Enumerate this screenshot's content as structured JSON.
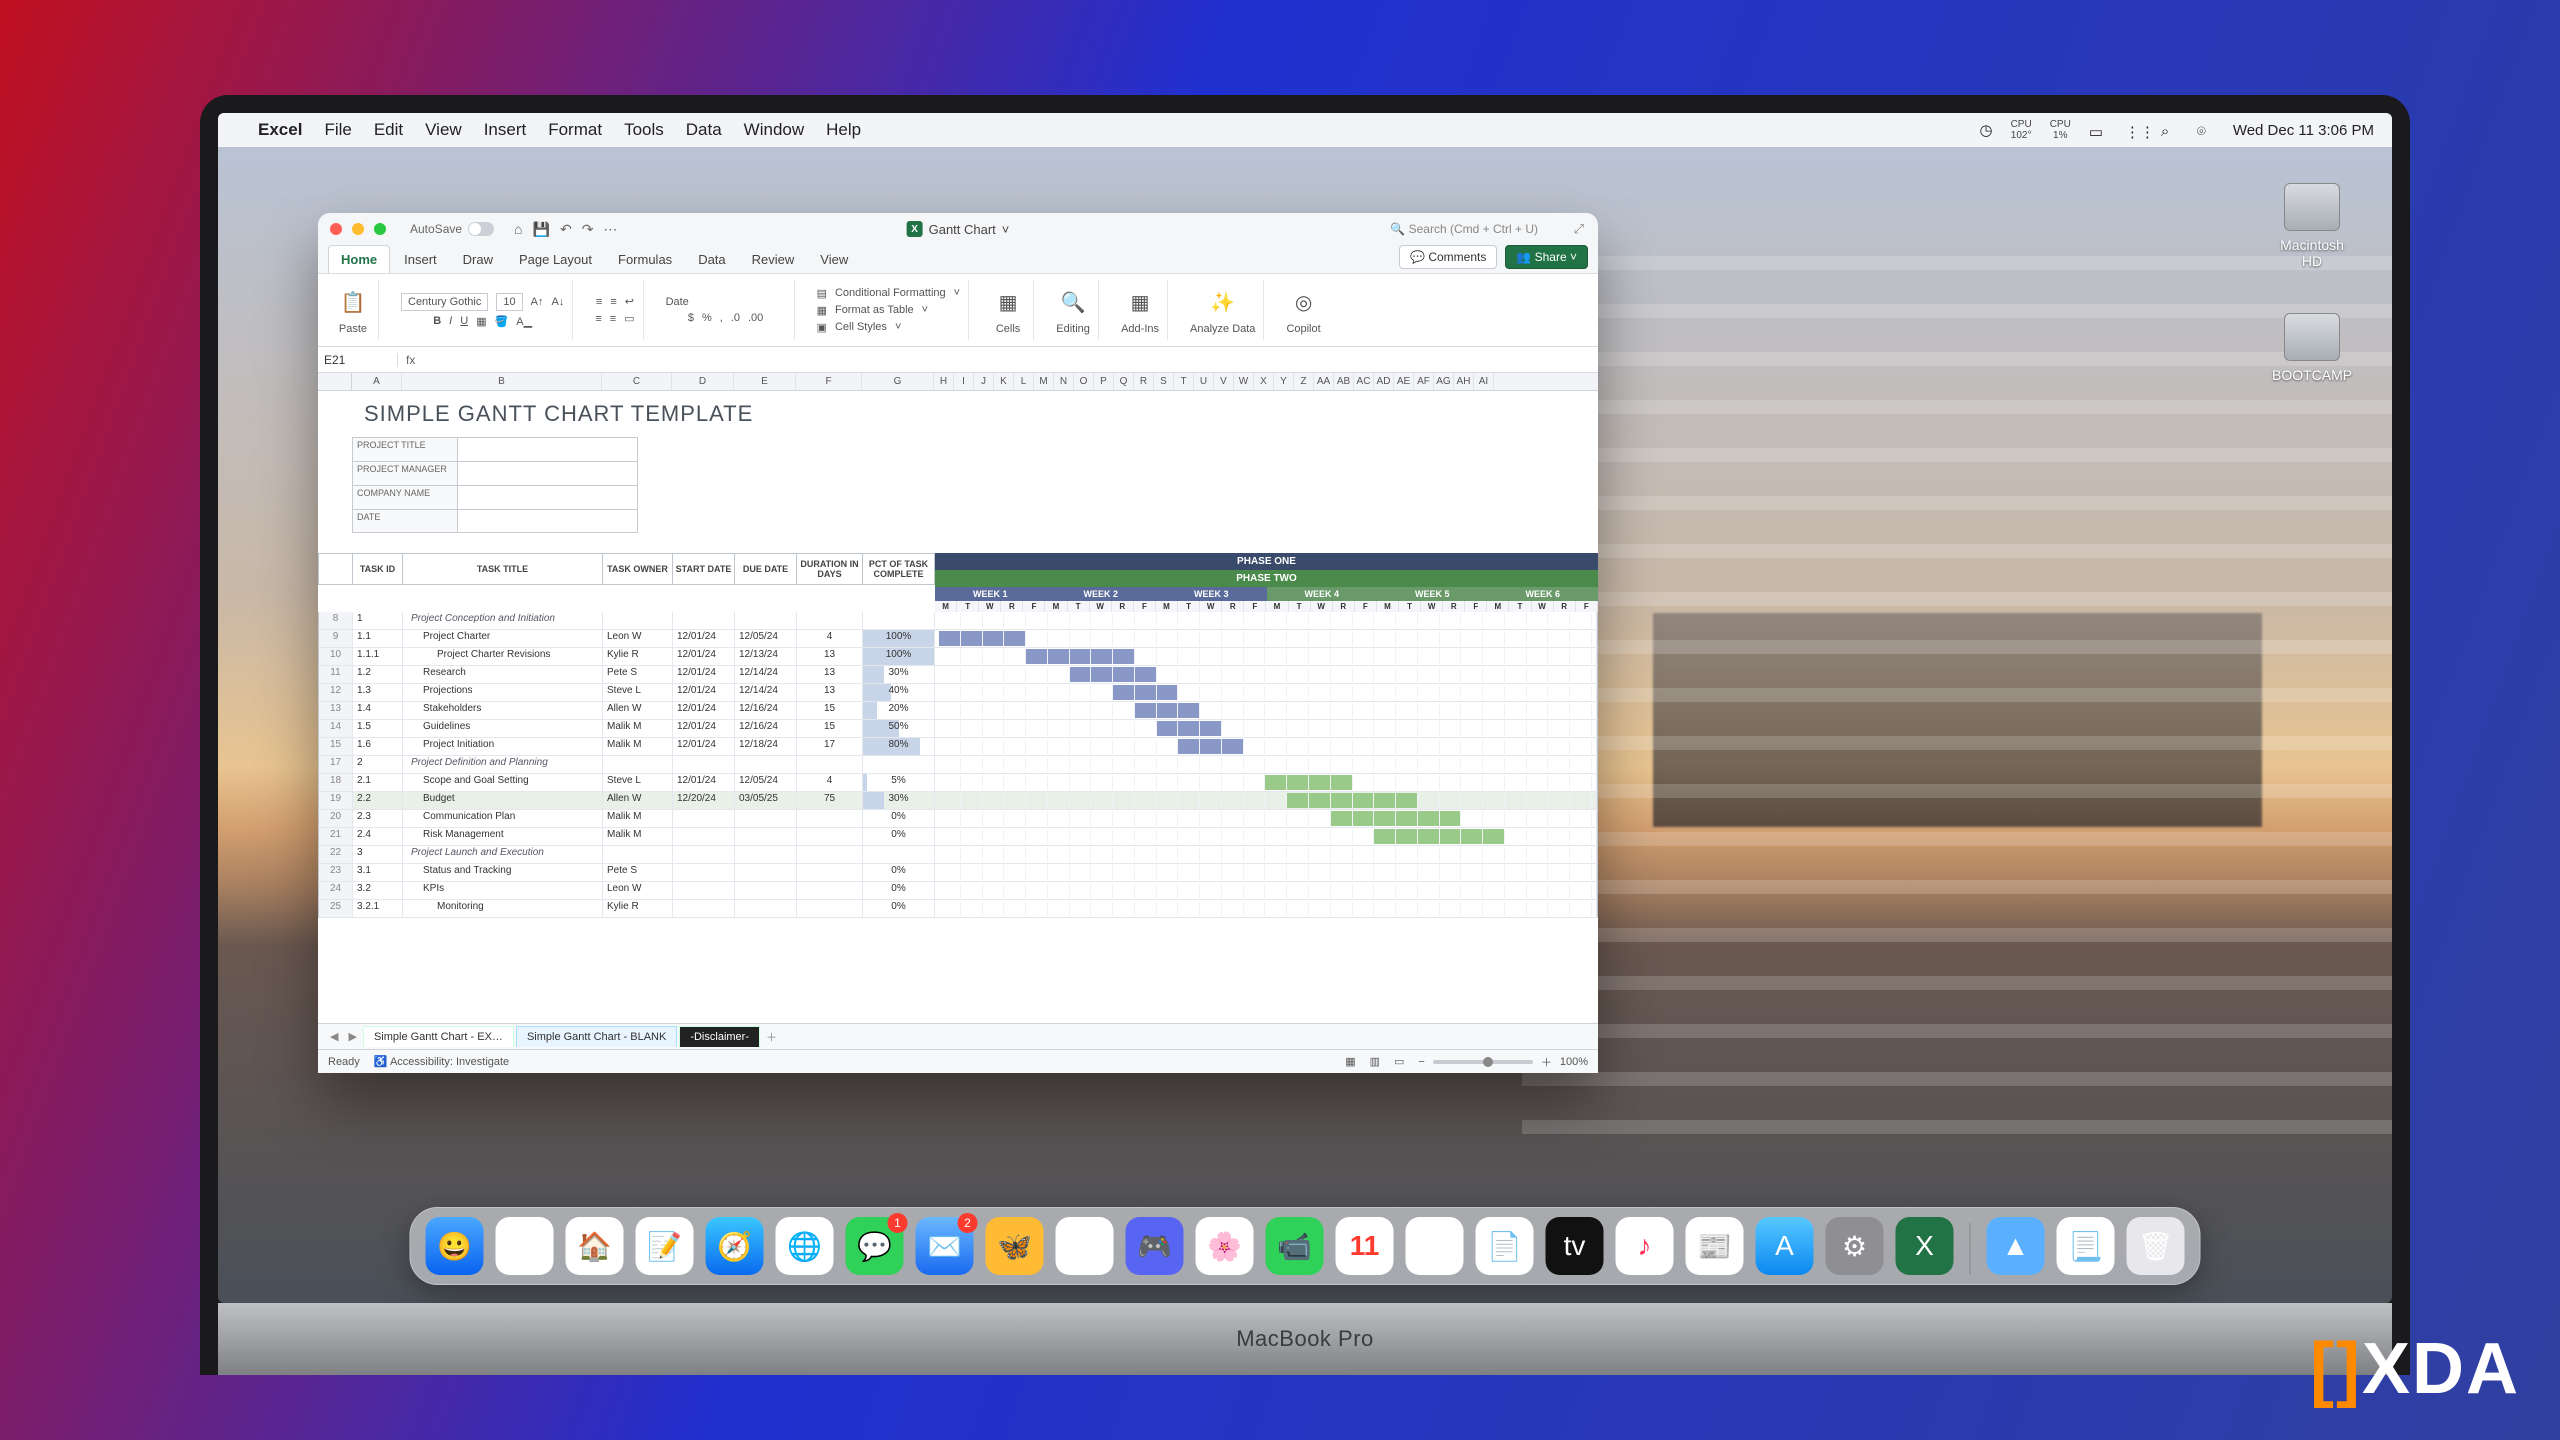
{
  "menubar": {
    "app": "Excel",
    "items": [
      "File",
      "Edit",
      "View",
      "Insert",
      "Format",
      "Tools",
      "Data",
      "Window",
      "Help"
    ],
    "cpu": {
      "label": "CPU",
      "value": "102°"
    },
    "gpu": {
      "label": "CPU",
      "value": "1%"
    },
    "datetime": "Wed Dec 11  3:06 PM"
  },
  "drives": [
    {
      "name": "Macintosh HD"
    },
    {
      "name": "BOOTCAMP"
    }
  ],
  "dock": {
    "messagesBadge": "1",
    "mailBadge": "2",
    "calendarDay": "11"
  },
  "chin": "MacBook Pro",
  "watermark": "XDA",
  "excel": {
    "autosave": "AutoSave",
    "docname": "Gantt Chart",
    "search": "Search (Cmd + Ctrl + U)",
    "tabs": [
      "Home",
      "Insert",
      "Draw",
      "Page Layout",
      "Formulas",
      "Data",
      "Review",
      "View"
    ],
    "activeTab": "Home",
    "comments": "Comments",
    "share": "Share",
    "font": {
      "name": "Century Gothic",
      "size": "10"
    },
    "numberFormat": "Date",
    "ribbonGroups": {
      "paste": "Paste",
      "condFmt": "Conditional Formatting",
      "asTable": "Format as Table",
      "cellStyles": "Cell Styles",
      "cells": "Cells",
      "editing": "Editing",
      "addins": "Add-Ins",
      "analyze": "Analyze Data",
      "copilot": "Copilot"
    },
    "namebox": "E21",
    "cols": [
      "A",
      "B",
      "C",
      "D",
      "E",
      "F",
      "G",
      "H",
      "I",
      "J",
      "K",
      "L",
      "M",
      "N",
      "O",
      "P",
      "Q",
      "R",
      "S",
      "T",
      "U",
      "V",
      "W",
      "X",
      "Y",
      "Z",
      "AA",
      "AB",
      "AC",
      "AD",
      "AE",
      "AF",
      "AG",
      "AH",
      "AI"
    ],
    "title": "SIMPLE GANTT CHART TEMPLATE",
    "metaLabels": [
      "PROJECT TITLE",
      "PROJECT MANAGER",
      "COMPANY NAME",
      "DATE"
    ],
    "gantt": {
      "phases": [
        "PHASE ONE",
        "PHASE TWO"
      ],
      "weeks": [
        "WEEK 1",
        "WEEK 2",
        "WEEK 3",
        "WEEK 4",
        "WEEK 5",
        "WEEK 6"
      ],
      "daycycle": [
        "M",
        "T",
        "W",
        "R",
        "F",
        "M",
        "T",
        "W",
        "R",
        "F",
        "M",
        "T",
        "W",
        "R",
        "F",
        "M",
        "T",
        "W",
        "R",
        "F",
        "M",
        "T",
        "W",
        "R",
        "F",
        "M",
        "T",
        "W",
        "R",
        "F"
      ],
      "headers": [
        "TASK ID",
        "TASK TITLE",
        "TASK OWNER",
        "START DATE",
        "DUE DATE",
        "DURATION IN DAYS",
        "PCT OF TASK COMPLETE"
      ]
    },
    "rows": [
      {
        "rn": 8,
        "id": "1",
        "title": "Project Conception and Initiation",
        "section": true,
        "phase": 1
      },
      {
        "rn": 9,
        "id": "1.1",
        "title": "Project Charter",
        "owner": "Leon W",
        "start": "12/01/24",
        "due": "12/05/24",
        "dur": "4",
        "pct": 100,
        "tl": [
          0,
          4
        ],
        "phase": 1,
        "indent": 1
      },
      {
        "rn": 10,
        "id": "1.1.1",
        "title": "Project Charter Revisions",
        "owner": "Kylie R",
        "start": "12/01/24",
        "due": "12/13/24",
        "dur": "13",
        "pct": 100,
        "tl": [
          4,
          9
        ],
        "phase": 1,
        "indent": 2
      },
      {
        "rn": 11,
        "id": "1.2",
        "title": "Research",
        "owner": "Pete S",
        "start": "12/01/24",
        "due": "12/14/24",
        "dur": "13",
        "pct": 30,
        "tl": [
          6,
          10
        ],
        "phase": 1,
        "indent": 1
      },
      {
        "rn": 12,
        "id": "1.3",
        "title": "Projections",
        "owner": "Steve L",
        "start": "12/01/24",
        "due": "12/14/24",
        "dur": "13",
        "pct": 40,
        "tl": [
          8,
          11
        ],
        "phase": 1,
        "indent": 1
      },
      {
        "rn": 13,
        "id": "1.4",
        "title": "Stakeholders",
        "owner": "Allen W",
        "start": "12/01/24",
        "due": "12/16/24",
        "dur": "15",
        "pct": 20,
        "tl": [
          9,
          12
        ],
        "phase": 1,
        "indent": 1
      },
      {
        "rn": 14,
        "id": "1.5",
        "title": "Guidelines",
        "owner": "Malik M",
        "start": "12/01/24",
        "due": "12/16/24",
        "dur": "15",
        "pct": 50,
        "tl": [
          10,
          13
        ],
        "phase": 1,
        "indent": 1
      },
      {
        "rn": 15,
        "id": "1.6",
        "title": "Project Initiation",
        "owner": "Malik M",
        "start": "12/01/24",
        "due": "12/18/24",
        "dur": "17",
        "pct": 80,
        "tl": [
          11,
          14
        ],
        "phase": 1,
        "indent": 1
      },
      {
        "rn": 17,
        "id": "2",
        "title": "Project Definition and Planning",
        "section": true,
        "phase": 2
      },
      {
        "rn": 18,
        "id": "2.1",
        "title": "Scope and Goal Setting",
        "owner": "Steve L",
        "start": "12/01/24",
        "due": "12/05/24",
        "dur": "4",
        "pct": 5,
        "tl": [
          15,
          19
        ],
        "phase": 2,
        "indent": 1
      },
      {
        "rn": 19,
        "id": "2.2",
        "title": "Budget",
        "owner": "Allen W",
        "start": "12/20/24",
        "due": "03/05/25",
        "dur": "75",
        "pct": 30,
        "tl": [
          16,
          22
        ],
        "phase": 2,
        "indent": 1,
        "sel": true
      },
      {
        "rn": 20,
        "id": "2.3",
        "title": "Communication Plan",
        "owner": "Malik M",
        "start": "",
        "due": "",
        "dur": "",
        "pct": 0,
        "tl": [
          18,
          24
        ],
        "phase": 2,
        "indent": 1
      },
      {
        "rn": 21,
        "id": "2.4",
        "title": "Risk Management",
        "owner": "Malik M",
        "start": "",
        "due": "",
        "dur": "",
        "pct": 0,
        "tl": [
          20,
          26
        ],
        "phase": 2,
        "indent": 1
      },
      {
        "rn": 22,
        "id": "3",
        "title": "Project Launch and Execution",
        "section": true,
        "phase": 2
      },
      {
        "rn": 23,
        "id": "3.1",
        "title": "Status and Tracking",
        "owner": "Pete S",
        "start": "",
        "due": "",
        "dur": "",
        "pct": 0,
        "indent": 1
      },
      {
        "rn": 24,
        "id": "3.2",
        "title": "KPIs",
        "owner": "Leon W",
        "start": "",
        "due": "",
        "dur": "",
        "pct": 0,
        "indent": 1
      },
      {
        "rn": 25,
        "id": "3.2.1",
        "title": "Monitoring",
        "owner": "Kylie R",
        "start": "",
        "due": "",
        "dur": "",
        "pct": 0,
        "indent": 2
      }
    ],
    "sheettabs": [
      "Simple Gantt Chart - EX…",
      "Simple Gantt Chart - BLANK",
      "-Disclaimer-"
    ],
    "status": {
      "ready": "Ready",
      "acc": "Accessibility: Investigate",
      "zoom": "100%"
    }
  }
}
